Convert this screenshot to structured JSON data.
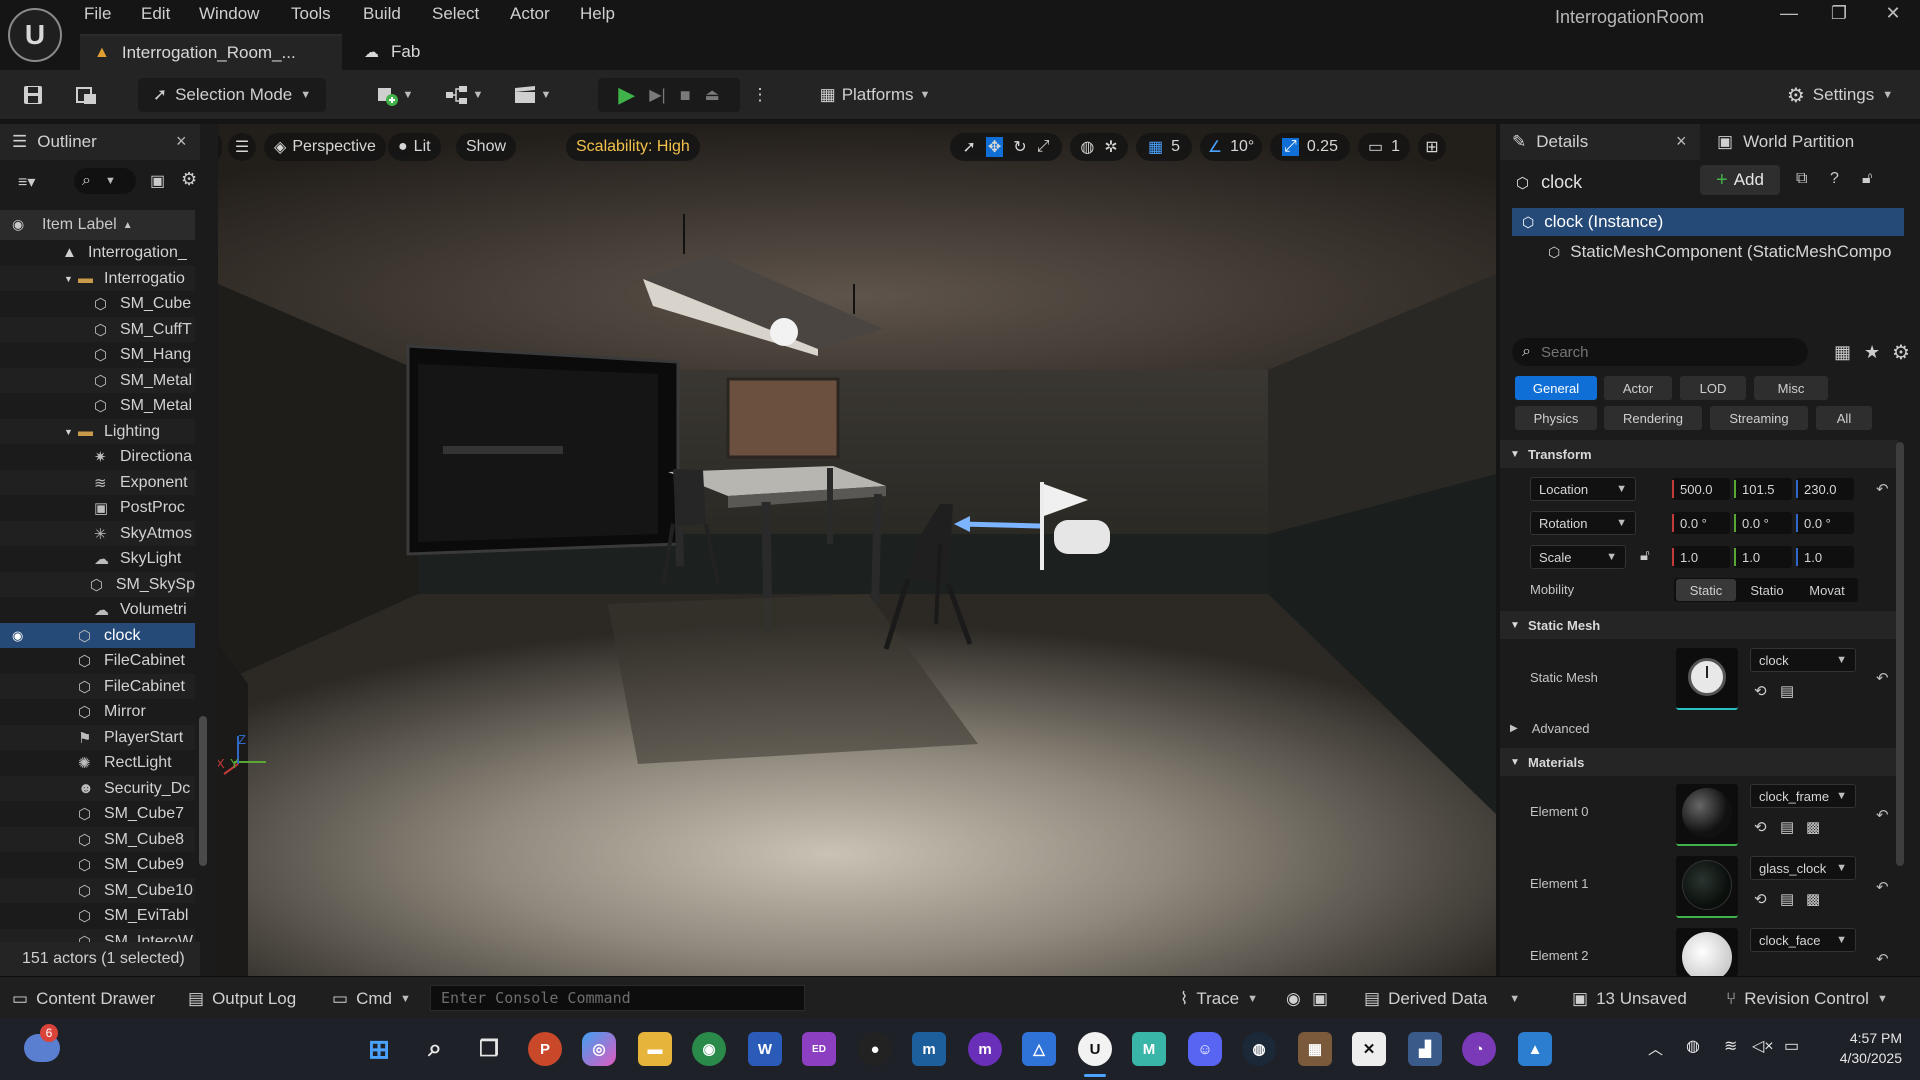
{
  "app": {
    "window_title": "InterrogationRoom",
    "menu": [
      "File",
      "Edit",
      "Window",
      "Tools",
      "Build",
      "Select",
      "Actor",
      "Help"
    ],
    "doc_tabs": [
      {
        "label": "Interrogation_Room_..."
      },
      {
        "label": "Fab"
      }
    ],
    "window_controls": {
      "minimize": "—",
      "maximize": "❐",
      "close": "✕"
    }
  },
  "toolbar": {
    "selection_mode": "Selection Mode",
    "platforms": "Platforms",
    "settings": "Settings"
  },
  "outliner": {
    "title": "Outliner",
    "close": "×",
    "column_header": "Item Label",
    "rows": [
      {
        "label": "Interrogation_",
        "icon": "level-icon",
        "indent": 1
      },
      {
        "label": "Interrogatio",
        "icon": "folder-icon",
        "indent": 2
      },
      {
        "label": "SM_Cube",
        "icon": "static-mesh-icon",
        "indent": 3
      },
      {
        "label": "SM_CuffT",
        "icon": "static-mesh-icon",
        "indent": 3
      },
      {
        "label": "SM_Hang",
        "icon": "static-mesh-icon",
        "indent": 3
      },
      {
        "label": "SM_Metal",
        "icon": "static-mesh-icon",
        "indent": 3
      },
      {
        "label": "SM_Metal",
        "icon": "static-mesh-icon",
        "indent": 3
      },
      {
        "label": "Lighting",
        "icon": "folder-icon",
        "indent": 2
      },
      {
        "label": "Directiona",
        "icon": "directional-light-icon",
        "indent": 3
      },
      {
        "label": "Exponent",
        "icon": "fog-icon",
        "indent": 3
      },
      {
        "label": "PostProc",
        "icon": "postprocess-icon",
        "indent": 3
      },
      {
        "label": "SkyAtmos",
        "icon": "sky-atmosphere-icon",
        "indent": 3
      },
      {
        "label": "SkyLight",
        "icon": "skylight-icon",
        "indent": 3
      },
      {
        "label": "SM_SkySp",
        "icon": "static-mesh-icon",
        "indent": 3
      },
      {
        "label": "Volumetri",
        "icon": "cloud-icon",
        "indent": 3
      },
      {
        "label": "clock",
        "icon": "static-mesh-icon",
        "indent": 2,
        "selected": true
      },
      {
        "label": "FileCabinet",
        "icon": "static-mesh-icon",
        "indent": 2
      },
      {
        "label": "FileCabinet",
        "icon": "static-mesh-icon",
        "indent": 2
      },
      {
        "label": "Mirror",
        "icon": "static-mesh-icon",
        "indent": 2
      },
      {
        "label": "PlayerStart",
        "icon": "player-start-icon",
        "indent": 2
      },
      {
        "label": "RectLight",
        "icon": "rect-light-icon",
        "indent": 2
      },
      {
        "label": "Security_Dc",
        "icon": "character-icon",
        "indent": 2
      },
      {
        "label": "SM_Cube7",
        "icon": "static-mesh-icon",
        "indent": 2
      },
      {
        "label": "SM_Cube8",
        "icon": "static-mesh-icon",
        "indent": 2
      },
      {
        "label": "SM_Cube9",
        "icon": "static-mesh-icon",
        "indent": 2
      },
      {
        "label": "SM_Cube10",
        "icon": "static-mesh-icon",
        "indent": 2
      },
      {
        "label": "SM_EviTabl",
        "icon": "static-mesh-icon",
        "indent": 2
      },
      {
        "label": "SM_InteroW",
        "icon": "static-mesh-icon",
        "indent": 2
      }
    ],
    "status": "151 actors (1 selected)"
  },
  "viewport": {
    "view_mode": "Perspective",
    "lighting": "Lit",
    "show": "Show",
    "scalability": "Scalability: High",
    "grid_snap": "5",
    "rotation_snap": "10°",
    "scale_snap": "0.25",
    "camera_speed": "1",
    "axis_labels": {
      "z": "Z",
      "x": "X",
      "y": "Y"
    }
  },
  "details": {
    "tab_label": "Details",
    "tab_close": "×",
    "world_partition": "World Partition",
    "actor_name": "clock",
    "add_label": "Add",
    "components": [
      "clock (Instance)",
      "StaticMeshComponent (StaticMeshCompo"
    ],
    "search_placeholder": "Search",
    "categories_row1": [
      "General",
      "Actor",
      "LOD",
      "Misc"
    ],
    "categories_row2": [
      "Physics",
      "Rendering",
      "Streaming",
      "All"
    ],
    "transform": {
      "title": "Transform",
      "location_label": "Location",
      "location": [
        "500.0",
        "101.5",
        "230.0"
      ],
      "rotation_label": "Rotation",
      "rotation": [
        "0.0 °",
        "0.0 °",
        "0.0 °"
      ],
      "scale_label": "Scale",
      "scale": [
        "1.0",
        "1.0",
        "1.0"
      ],
      "mobility_label": "Mobility",
      "mobility_options": [
        "Static",
        "Statio",
        "Movat"
      ]
    },
    "static_mesh": {
      "title": "Static Mesh",
      "label": "Static Mesh",
      "value": "clock"
    },
    "advanced": "Advanced",
    "materials": {
      "title": "Materials",
      "elements": [
        {
          "label": "Element 0",
          "value": "clock_frame"
        },
        {
          "label": "Element 1",
          "value": "glass_clock"
        },
        {
          "label": "Element 2",
          "value": "clock_face"
        }
      ]
    }
  },
  "bottombar": {
    "content_drawer": "Content Drawer",
    "output_log": "Output Log",
    "cmd": "Cmd",
    "console_placeholder": "Enter Console Command",
    "trace": "Trace",
    "derived_data": "Derived Data",
    "unsaved": "13 Unsaved",
    "revision_control": "Revision Control"
  },
  "taskbar": {
    "weather_badge": "6",
    "time": "4:57 PM",
    "date": "4/30/2025"
  },
  "colors": {
    "accent_blue": "#0f6fd6",
    "selection": "#264a78",
    "play_green": "#3fb24a",
    "scalability_yellow": "#f2c24a"
  }
}
